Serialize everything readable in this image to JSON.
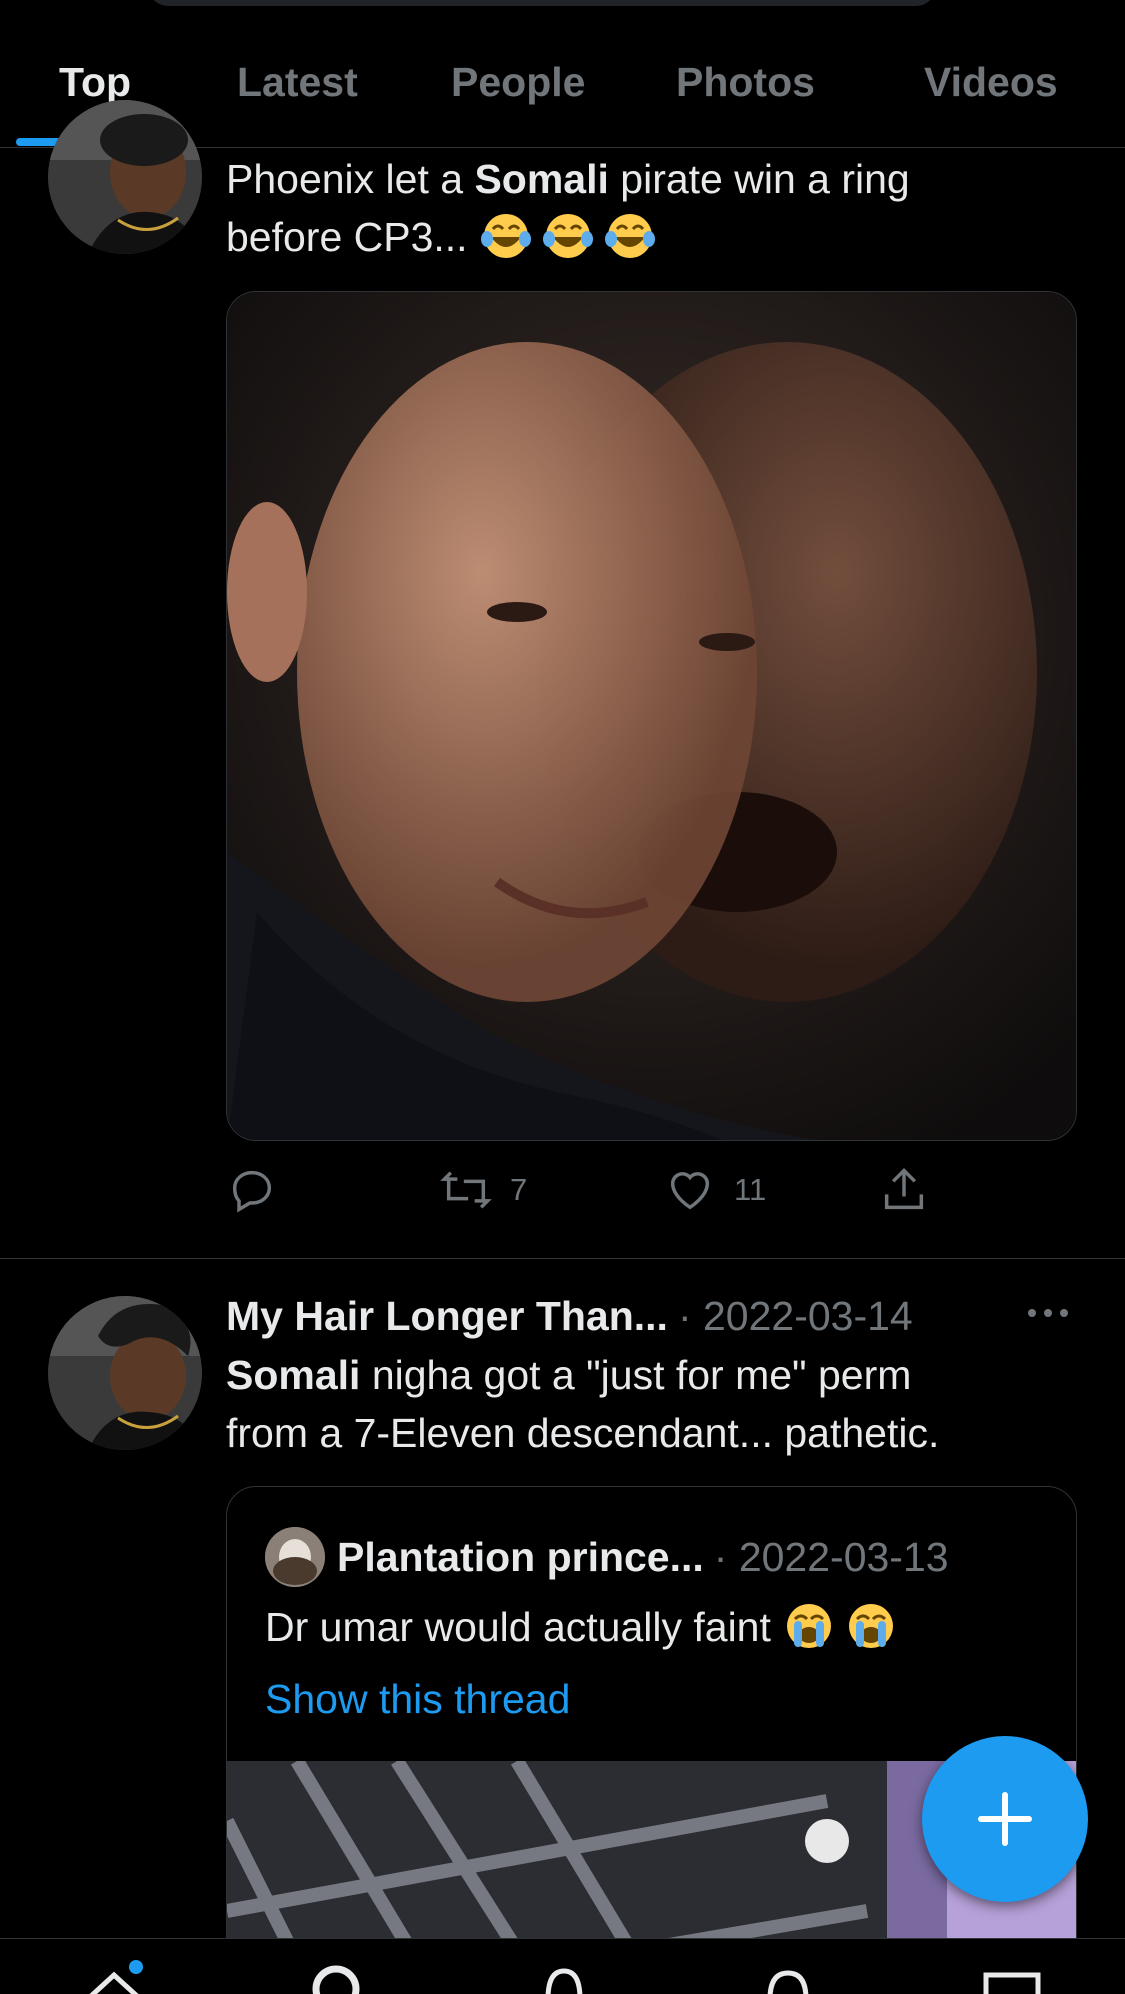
{
  "tabs": [
    {
      "label": "Top",
      "active": true
    },
    {
      "label": "Latest",
      "active": false
    },
    {
      "label": "People",
      "active": false
    },
    {
      "label": "Photos",
      "active": false
    },
    {
      "label": "Videos",
      "active": false
    }
  ],
  "tweet1": {
    "text_pre": "Phoenix let a ",
    "text_bold": "Somali",
    "text_post": " pirate win a ring",
    "text_line2": "before CP3... ",
    "emoji": "face-with-tears-of-joy",
    "retweets": "7",
    "likes": "11"
  },
  "tweet2": {
    "name": "My Hair Longer Than...",
    "date": "· 2022-03-14",
    "text_bold": "Somali",
    "text_rest": " nigha got a \"just for me\" perm",
    "text_line2": "from a 7-Eleven descendant... pathetic.",
    "quote": {
      "name": "Plantation prince...",
      "date": "· 2022-03-13",
      "text": "Dr umar would actually faint ",
      "emoji": "loudly-crying-face",
      "link": "Show this thread"
    }
  },
  "colors": {
    "accent": "#1d9bf0",
    "background": "#000000",
    "secondary_text": "#71767b",
    "divider": "#2f3336"
  }
}
